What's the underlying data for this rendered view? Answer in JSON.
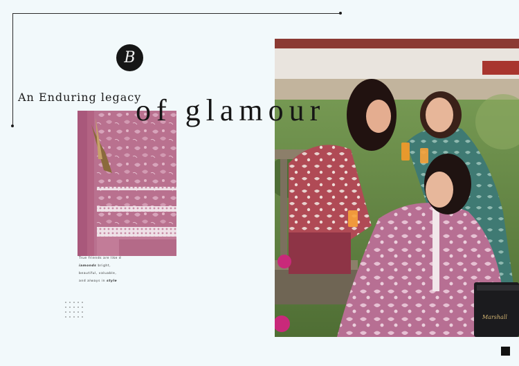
{
  "logo": {
    "letter": "B"
  },
  "headline": {
    "line1": "An Enduring legacy",
    "line2": "of glamour"
  },
  "quote": {
    "line1_pre": "True friends are like d",
    "line2_italic": "iamonds",
    "line2_post": " bright,",
    "line3": "beautiful, valuable,",
    "line4_pre": "and always in ",
    "line4_italic": "style"
  },
  "speaker": {
    "brand": "Marshall"
  },
  "colors": {
    "background": "#f2f9fb",
    "fabric_pink": "#b9718f",
    "teal_suit": "#3f7a73",
    "maroon": "#8e3446"
  }
}
